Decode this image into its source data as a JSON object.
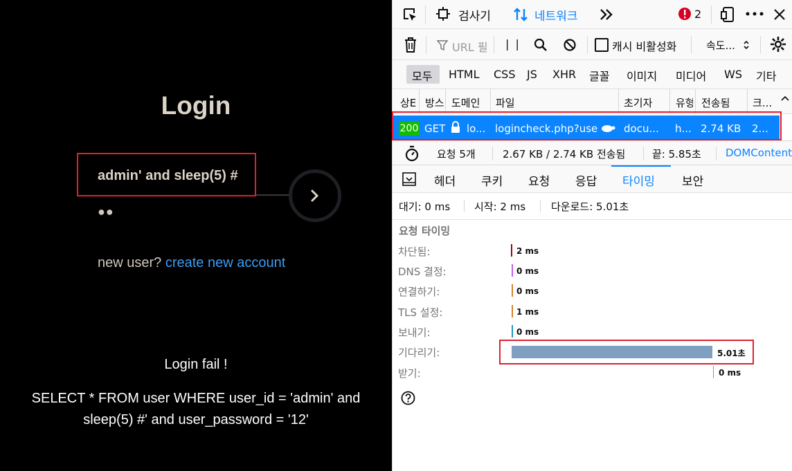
{
  "login": {
    "title": "Login",
    "username_value": "admin' and sleep(5) #",
    "password_dots": "●●",
    "new_user_text": "new user?",
    "create_link": "create new account",
    "result_title": "Login fail !",
    "query_line1": "SELECT * FROM user WHERE user_id = 'admin' and",
    "query_line2": "sleep(5) #' and user_password = '12'"
  },
  "devtools": {
    "tabs": {
      "inspector": "검사기",
      "network": "네트워크",
      "error_count": "2"
    },
    "toolbar": {
      "filter_placeholder": "URL 필",
      "pause_label": "| |",
      "cache_label": "캐시 비활성화",
      "throttle_label": "속도..."
    },
    "type_filters": [
      "모두",
      "HTML",
      "CSS",
      "JS",
      "XHR",
      "글꼴",
      "이미지",
      "미디어",
      "WS",
      "기타"
    ],
    "columns": [
      "상E",
      "방스",
      "도메인",
      "파일",
      "초기자",
      "유형",
      "전송됨",
      "크..."
    ],
    "request": {
      "status": "200",
      "method": "GET",
      "domain": "lo...",
      "file": "logincheck.php?use",
      "initiator": "docu...",
      "type": "h...",
      "transferred": "2.74 KB",
      "size": "2..."
    },
    "summary": {
      "requests": "요청 5개",
      "transferred": "2.67 KB / 2.74 KB 전송됨",
      "finish": "끝: 5.85초",
      "domcontent": "DOMContent"
    },
    "detail_tabs": [
      "헤더",
      "쿠키",
      "요청",
      "응답",
      "타이밍",
      "보안"
    ],
    "timing_header": {
      "queued": "대기: 0 ms",
      "started": "시작: 2 ms",
      "downloaded": "다운로드: 5.01초"
    },
    "timing_section": "요청 타이밍",
    "timings": [
      {
        "label": "차단됨:",
        "value": "2 ms",
        "color": "#a4000f"
      },
      {
        "label": "DNS 결정:",
        "value": "0 ms",
        "color": "#c55ce8"
      },
      {
        "label": "연결하기:",
        "value": "0 ms",
        "color": "#d7812a"
      },
      {
        "label": "TLS 설정:",
        "value": "1 ms",
        "color": "#d7812a"
      },
      {
        "label": "보내기:",
        "value": "0 ms",
        "color": "#1b96c4"
      },
      {
        "label": "기다리기:",
        "value": "5.01초",
        "color": "#7f9fc0"
      },
      {
        "label": "받기:",
        "value": "0 ms",
        "color": "#58c34b"
      }
    ]
  },
  "colors": {
    "accent": "#0a84ff",
    "highlight_border": "#e02030",
    "link": "#3d9cf5"
  }
}
